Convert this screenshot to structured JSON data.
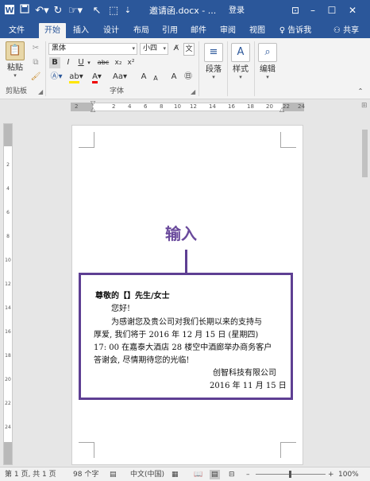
{
  "titlebar": {
    "document_title": "邀请函.docx - ...",
    "login": "登录"
  },
  "tabs": [
    "文件",
    "开始",
    "插入",
    "设计",
    "布局",
    "引用",
    "邮件",
    "审阅",
    "视图"
  ],
  "tell_me": "告诉我",
  "share": "共享",
  "ribbon": {
    "clipboard": {
      "paste_label": "粘贴",
      "group_label": "剪贴板"
    },
    "font": {
      "font_name": "黑体",
      "font_size": "小四",
      "bold": "B",
      "italic": "I",
      "underline": "U",
      "strike": "abc",
      "subscript": "x₂",
      "superscript": "x²",
      "case": "Aa",
      "grow": "A",
      "shrink": "A",
      "group_label": "字体"
    },
    "paragraph_label": "段落",
    "styles_label": "样式",
    "editing_label": "编辑"
  },
  "ruler": {
    "h_ticks": [
      "2",
      "2",
      "4",
      "6",
      "8",
      "10",
      "12",
      "14",
      "16",
      "18",
      "20",
      "22",
      "24"
    ],
    "v_ticks": [
      "2",
      "4",
      "6",
      "8",
      "10",
      "12",
      "14",
      "16",
      "18",
      "20",
      "22",
      "24"
    ]
  },
  "annotation": {
    "label": "输入"
  },
  "document": {
    "greeting": "尊敬的【】先生/女士",
    "hello": "您好!",
    "lines": [
      "为感谢您及贵公司对我们长期以来的支持与",
      "厚爱, 我们将于 2016 年 12 月 15 日 (星期四)",
      "17: 00 在嘉泰大酒店 28 楼空中酒廊举办商务客户",
      "答谢会, 尽情期待您的光临!"
    ],
    "company": "创智科技有限公司",
    "date": "2016 年 11 月 15 日"
  },
  "status": {
    "page": "第 1 页, 共 1 页",
    "words": "98 个字",
    "language": "中文(中国)",
    "zoom": "100%"
  },
  "colors": {
    "title_blue": "#2b579a",
    "annotation_purple": "#5e3f93"
  }
}
